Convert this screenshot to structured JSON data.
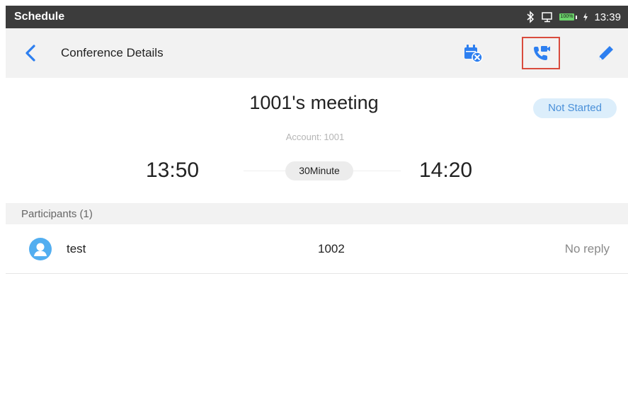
{
  "status_bar": {
    "app_title": "Schedule",
    "battery_label": "100%",
    "time": "13:39",
    "icons": [
      "bluetooth-icon",
      "screen-icon",
      "battery-icon",
      "charging-icon"
    ]
  },
  "toolbar": {
    "title": "Conference Details",
    "icons": [
      "back-icon",
      "cancel-meeting-icon",
      "video-call-icon",
      "edit-icon"
    ],
    "highlight_color": "#d94b3d",
    "accent_color": "#2d7ff0"
  },
  "meeting": {
    "title": "1001's meeting",
    "status": "Not Started",
    "account_label": "Account:",
    "account_value": "1001",
    "start_time": "13:50",
    "end_time": "14:20",
    "duration": "30Minute"
  },
  "participants": {
    "header": "Participants (1)",
    "items": [
      {
        "name": "test",
        "number": "1002",
        "reply": "No reply"
      }
    ]
  }
}
